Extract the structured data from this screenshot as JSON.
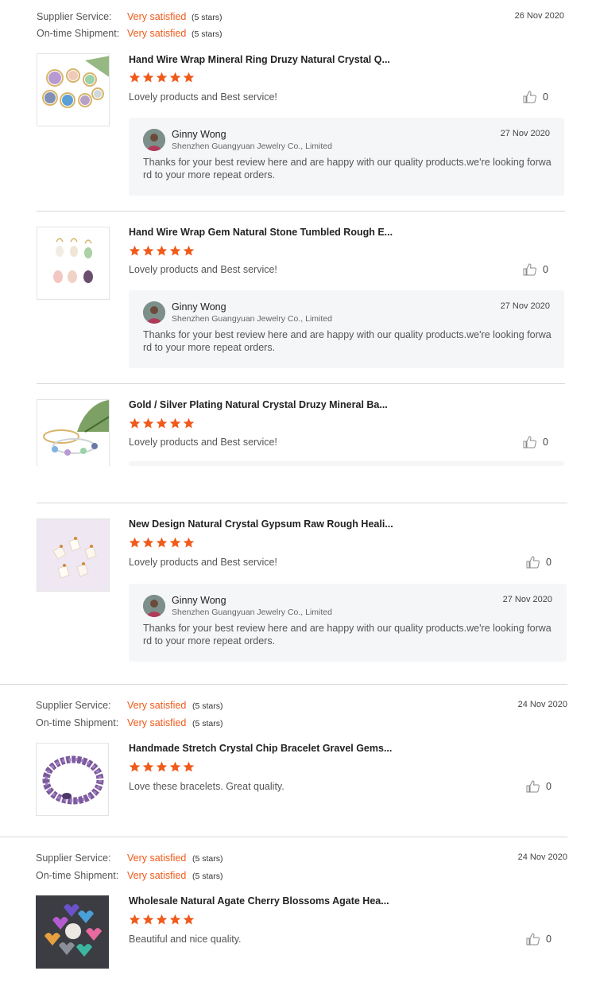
{
  "labels": {
    "supplier_service": "Supplier Service:",
    "ontime_shipment": "On-time Shipment:"
  },
  "groups": [
    {
      "date": "26 Nov 2020",
      "supplier_value": "Very satisfied",
      "supplier_stars": "(5 stars)",
      "shipment_value": "Very satisfied",
      "shipment_stars": "(5 stars)"
    },
    {
      "date": "24 Nov 2020",
      "supplier_value": "Very satisfied",
      "supplier_stars": "(5 stars)",
      "shipment_value": "Very satisfied",
      "shipment_stars": "(5 stars)"
    },
    {
      "date": "24 Nov 2020",
      "supplier_value": "Very satisfied",
      "supplier_stars": "(5 stars)",
      "shipment_value": "Very satisfied",
      "shipment_stars": "(5 stars)"
    }
  ],
  "reviews": [
    {
      "title": "Hand Wire Wrap Mineral Ring Druzy Natural Crystal Q...",
      "rating": 5,
      "comment": "Lovely products and Best service!",
      "likes": "0",
      "image_icon": "crystal-rings-image",
      "reply": {
        "name": "Ginny Wong",
        "company": "Shenzhen Guangyuan Jewelry Co., Limited",
        "date": "27 Nov 2020",
        "text": "Thanks for your best review here and are happy with our quality products.we're looking forward to your more repeat orders."
      }
    },
    {
      "title": "Hand Wire Wrap Gem Natural Stone Tumbled Rough E...",
      "rating": 5,
      "comment": "Lovely products and Best service!",
      "likes": "0",
      "image_icon": "gem-earrings-image",
      "reply": {
        "name": "Ginny Wong",
        "company": "Shenzhen Guangyuan Jewelry Co., Limited",
        "date": "27 Nov 2020",
        "text": "Thanks for your best review here and are happy with our quality products.we're looking forward to your more repeat orders."
      }
    },
    {
      "title": "Gold / Silver Plating Natural Crystal Druzy Mineral Ba...",
      "rating": 5,
      "comment": "Lovely products and Best service!",
      "likes": "0",
      "image_icon": "bangle-bracelets-image"
    },
    {
      "title": "New Design Natural Crystal Gypsum Raw Rough Heali...",
      "rating": 5,
      "comment": "Lovely products and Best service!",
      "likes": "0",
      "image_icon": "crystal-pendants-image",
      "reply": {
        "name": "Ginny Wong",
        "company": "Shenzhen Guangyuan Jewelry Co., Limited",
        "date": "27 Nov 2020",
        "text": "Thanks for your best review here and are happy with our quality products.we're looking forward to your more repeat orders."
      }
    },
    {
      "title": "Handmade Stretch Crystal Chip Bracelet Gravel Gems...",
      "rating": 5,
      "comment": "Love these bracelets. Great quality.",
      "likes": "0",
      "image_icon": "amethyst-bracelet-image"
    },
    {
      "title": "Wholesale Natural Agate Cherry Blossoms Agate Hea...",
      "rating": 5,
      "comment": "Beautiful and nice quality.",
      "likes": "0",
      "image_icon": "agate-hearts-image"
    }
  ],
  "colors": {
    "accent": "#f05a1a",
    "star": "#f05a1a",
    "reply_bg": "#f5f6f8",
    "divider": "#d8d8d8"
  }
}
